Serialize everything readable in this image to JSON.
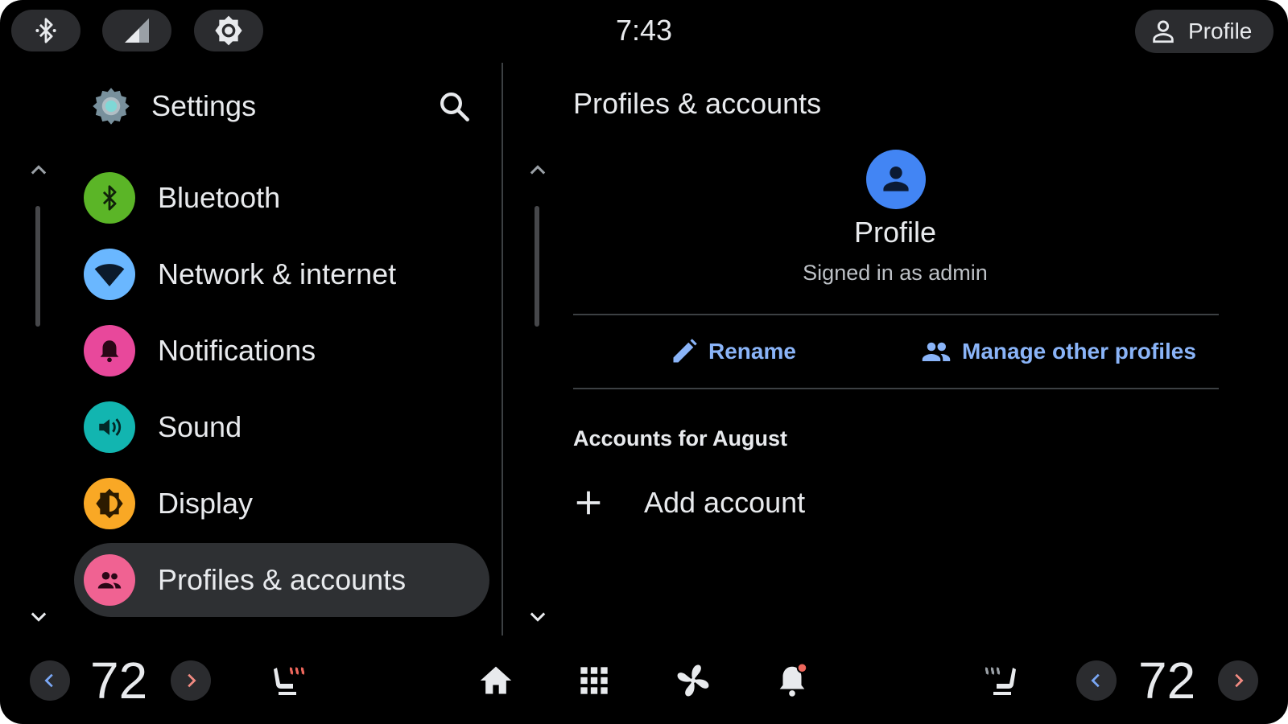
{
  "status_bar": {
    "time": "7:43",
    "profile_label": "Profile",
    "quick_icons": [
      "bluetooth-icon",
      "signal-icon",
      "brightness-icon"
    ]
  },
  "sidebar": {
    "title": "Settings",
    "items": [
      {
        "label": "Bluetooth",
        "icon": "bluetooth-icon",
        "color": "#5bb527"
      },
      {
        "label": "Network & internet",
        "icon": "wifi-icon",
        "color": "#6ab7ff"
      },
      {
        "label": "Notifications",
        "icon": "bell-icon",
        "color": "#e8489b"
      },
      {
        "label": "Sound",
        "icon": "volume-icon",
        "color": "#12b5b0"
      },
      {
        "label": "Display",
        "icon": "brightness-icon",
        "color": "#f9a825"
      },
      {
        "label": "Profiles & accounts",
        "icon": "people-icon",
        "color": "#f06292",
        "selected": true
      }
    ]
  },
  "detail": {
    "title": "Profiles & accounts",
    "profile_name": "Profile",
    "signed_in_text": "Signed in as admin",
    "rename_label": "Rename",
    "manage_label": "Manage other profiles",
    "section_title": "Accounts for August",
    "add_account_label": "Add account"
  },
  "bottom_bar": {
    "left_temp": "72",
    "right_temp": "72",
    "icons": [
      "seat-heat-left-icon",
      "home-icon",
      "apps-grid-icon",
      "fan-icon",
      "notification-bell-icon",
      "seat-heat-right-icon"
    ]
  },
  "colors": {
    "accent_blue": "#8ab4f8",
    "avatar_blue": "#4285f4",
    "arrow_blue": "#7aa7f5",
    "arrow_red": "#f28b82",
    "heat_red": "#ee675c"
  }
}
